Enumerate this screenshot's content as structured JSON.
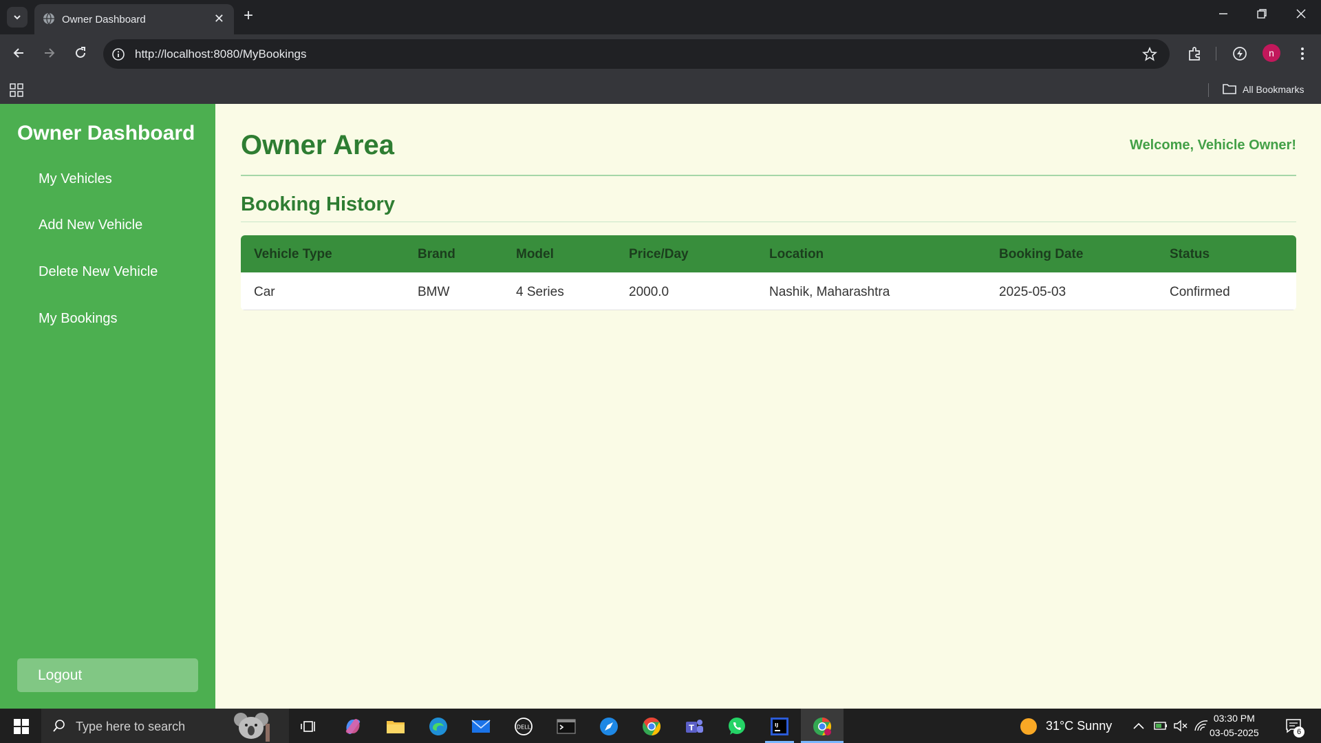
{
  "browser": {
    "tab_title": "Owner Dashboard",
    "url": "http://localhost:8080/MyBookings",
    "bookmarks_label": "All Bookmarks",
    "profile_initial": "n"
  },
  "sidebar": {
    "title": "Owner Dashboard",
    "items": [
      {
        "label": "My Vehicles"
      },
      {
        "label": "Add New Vehicle"
      },
      {
        "label": "Delete New Vehicle"
      },
      {
        "label": "My Bookings"
      }
    ],
    "logout_label": "Logout"
  },
  "header": {
    "title": "Owner Area",
    "welcome": "Welcome, Vehicle Owner!"
  },
  "bookings": {
    "title": "Booking History",
    "columns": [
      "Vehicle Type",
      "Brand",
      "Model",
      "Price/Day",
      "Location",
      "Booking Date",
      "Status"
    ],
    "rows": [
      [
        "Car",
        "BMW",
        "4 Series",
        "2000.0",
        "Nashik, Maharashtra",
        "2025-05-03",
        "Confirmed"
      ]
    ]
  },
  "taskbar": {
    "search_placeholder": "Type here to search",
    "weather": "31°C  Sunny",
    "time": "03:30 PM",
    "date": "03-05-2025",
    "notification_count": "6"
  },
  "colors": {
    "sidebar": "#4caf50",
    "page_bg": "#fafbe6",
    "heading_green": "#2e7d32",
    "table_header": "#388e3c",
    "logout_button": "#81c784"
  }
}
